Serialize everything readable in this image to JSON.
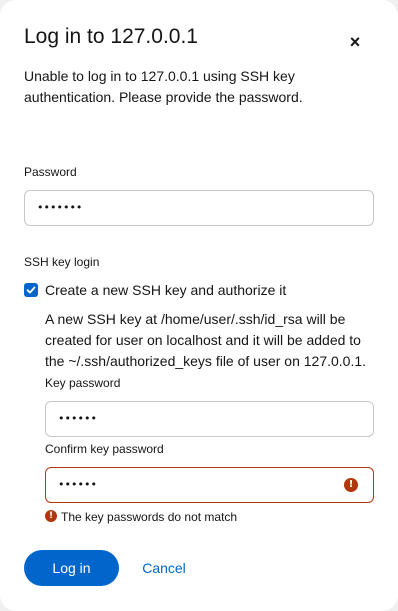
{
  "dialog": {
    "title": "Log in to 127.0.0.1",
    "close_symbol": "×",
    "description": "Unable to log in to 127.0.0.1 using SSH key authentication. Please provide the password."
  },
  "password": {
    "label": "Password",
    "value": "•••••••"
  },
  "ssh": {
    "section_label": "SSH key login",
    "checkbox_label": "Create a new SSH key and authorize it",
    "checkbox_checked": true,
    "description": "A new SSH key at /home/user/.ssh/id_rsa will be created for user on localhost and it will be added to the ~/.ssh/authorized_keys file of user on 127.0.0.1.",
    "key_password_label": "Key password",
    "key_password_value": "••••••",
    "confirm_label": "Confirm key password",
    "confirm_value": "••••••",
    "error_symbol": "!",
    "error_message": "The key passwords do not match"
  },
  "actions": {
    "login_label": "Log in",
    "cancel_label": "Cancel"
  },
  "colors": {
    "primary": "#0066cc",
    "error": "#b1380b"
  },
  "icons": [
    "close-icon",
    "checkmark-icon",
    "error-circle-icon"
  ]
}
